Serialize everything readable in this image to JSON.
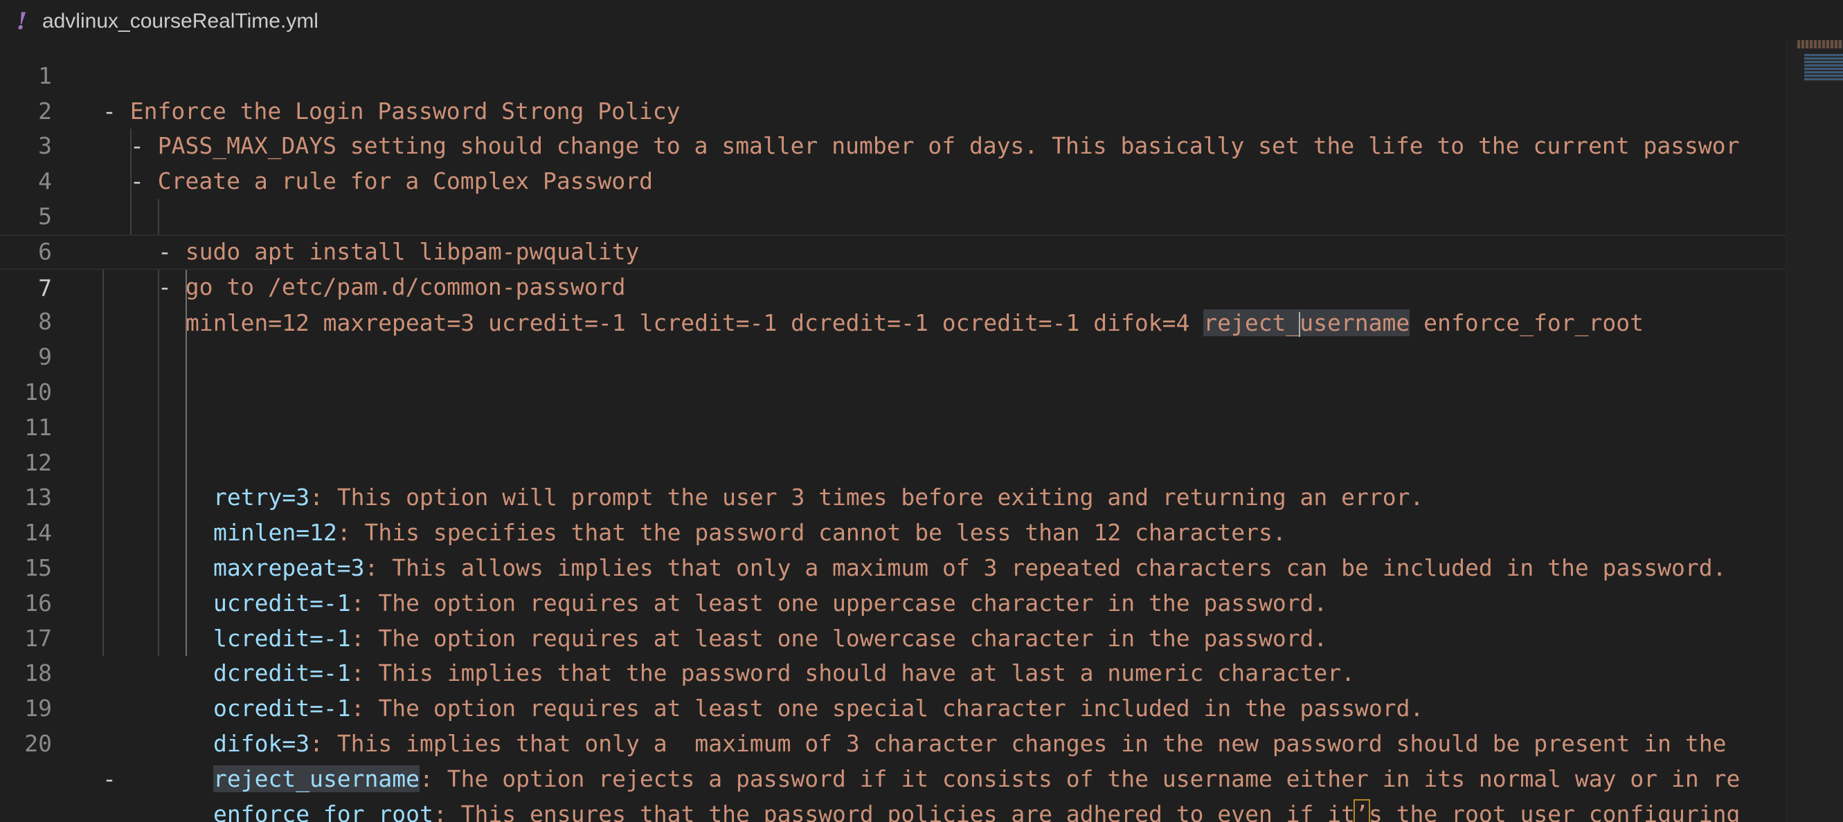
{
  "tab": {
    "icon": "yaml-icon",
    "icon_glyph": "!",
    "filename": "advlinux_courseRealTime.yml"
  },
  "editor": {
    "lines": [
      {
        "n": "1",
        "indent": 0,
        "dash": "- ",
        "text": "Enforce the Login Password Strong Policy"
      },
      {
        "n": "2",
        "indent": 1,
        "dash": "- ",
        "text": "PASS_MAX_DAYS setting should change to a smaller number of days. This basically set the life to the current passwor"
      },
      {
        "n": "3",
        "indent": 1,
        "dash": "- ",
        "text": "Create a rule for a Complex Password"
      },
      {
        "n": "4",
        "indent": 2,
        "dash": "- ",
        "text": "sudo apt install libpam-pwquality"
      },
      {
        "n": "5",
        "indent": 2,
        "dash": "- ",
        "text": "go to /etc/pam.d/common-password"
      },
      {
        "n": "6",
        "indent": 0,
        "dash": "",
        "text": ""
      },
      {
        "n": "7",
        "indent": 3,
        "dash": "",
        "text_before": "minlen=12 maxrepeat=3 ucredit=-1 lcredit=-1 dcredit=-1 ocredit=-1 difok=4 ",
        "hl_a": "reject_",
        "hl_b": "username",
        "text_after": " enforce_for_root"
      },
      {
        "n": "8",
        "indent": 0,
        "dash": "",
        "text": ""
      },
      {
        "n": "9",
        "indent": 4,
        "key": "retry=3",
        "text": ": This option will prompt the user 3 times before exiting and returning an error."
      },
      {
        "n": "10",
        "indent": 4,
        "key": "minlen=12",
        "text": ": This specifies that the password cannot be less than 12 characters."
      },
      {
        "n": "11",
        "indent": 4,
        "key": "maxrepeat=3",
        "text": ": This allows implies that only a maximum of 3 repeated characters can be included in the password."
      },
      {
        "n": "12",
        "indent": 4,
        "key": "ucredit=-1",
        "text": ": The option requires at least one uppercase character in the password."
      },
      {
        "n": "13",
        "indent": 4,
        "key": "lcredit=-1",
        "text": ": The option requires at least one lowercase character in the password."
      },
      {
        "n": "14",
        "indent": 4,
        "key": "dcredit=-1",
        "text": ": This implies that the password should have at last a numeric character."
      },
      {
        "n": "15",
        "indent": 4,
        "key": "ocredit=-1",
        "text": ": The option requires at least one special character included in the password."
      },
      {
        "n": "16",
        "indent": 4,
        "key": "difok=3",
        "text": ": This implies that only a  maximum of 3 character changes in the new password should be present in the"
      },
      {
        "n": "17",
        "indent": 4,
        "key": "reject_username",
        "text": ": The option rejects a password if it consists of the username either in its normal way or in re"
      },
      {
        "n": "18",
        "indent": 4,
        "key": "enforce_for_root",
        "text_a": ": This ensures that the password policies are adhered to even if it",
        "bracket": "’",
        "text_b": "s the root user configuring"
      },
      {
        "n": "19",
        "indent": 0,
        "dash": "",
        "text": ""
      },
      {
        "n": "20",
        "indent": 0,
        "dash": "-",
        "text": ""
      }
    ]
  },
  "colors": {
    "background": "#1f1f1f",
    "string": "#ce9178",
    "key": "#9cdcfe",
    "line_number": "#8a8a8a",
    "yaml_icon": "#a074c4"
  }
}
